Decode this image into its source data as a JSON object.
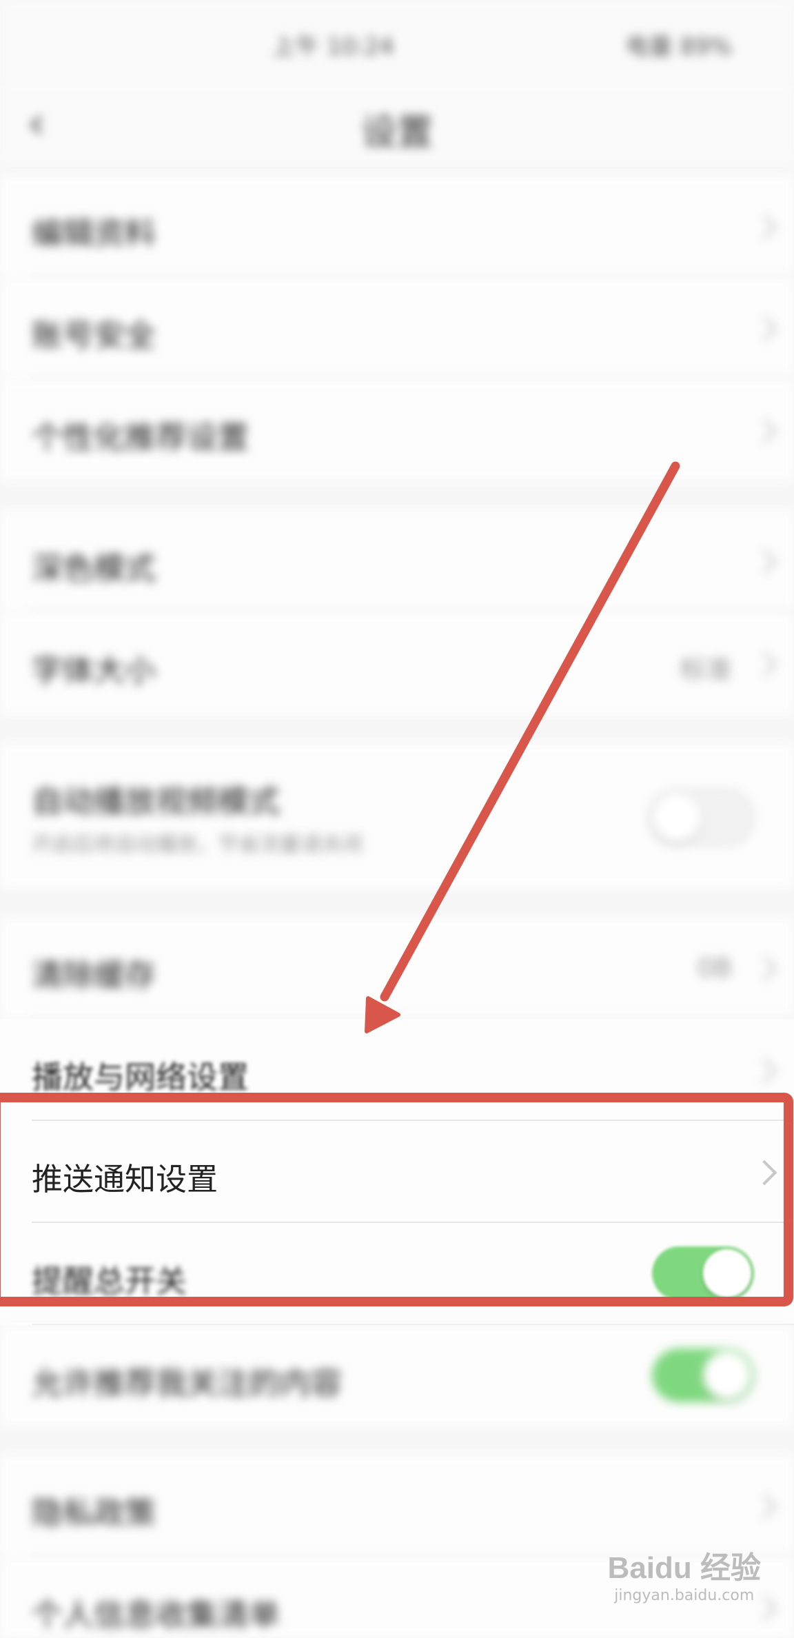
{
  "status_bar": {
    "left": "上午 10:24",
    "right": "电量 89%"
  },
  "nav": {
    "back_icon": "chevron-left-icon",
    "title": "设置"
  },
  "rows": {
    "edit_profile": {
      "label": "编辑资料"
    },
    "account_security": {
      "label": "账号安全"
    },
    "privacy_settings": {
      "label": "个性化推荐设置"
    },
    "dark_mode": {
      "label": "深色模式"
    },
    "font_size": {
      "label": "字体大小",
      "value": "标准"
    },
    "auto_play": {
      "label": "自动播放视频模式",
      "sub": "开启后将自动播放，节省流量请关闭"
    },
    "clear_cache": {
      "label": "清除缓存",
      "value": "0B"
    },
    "playback_network": {
      "label": "播放与网络设置"
    },
    "push_notification": {
      "label": "推送通知设置"
    },
    "reminder_switch": {
      "label": "提醒总开关"
    },
    "recommend_switch": {
      "label": "允许推荐我关注的内容"
    },
    "privacy_policy": {
      "label": "隐私政策"
    },
    "personal_info": {
      "label": "个人信息收集清单"
    }
  },
  "watermark": {
    "brand": "Baidu 经验",
    "url": "jingyan.baidu.com"
  },
  "colors": {
    "annotation": "#d9574a",
    "toggle_on": "#7fd87f"
  }
}
